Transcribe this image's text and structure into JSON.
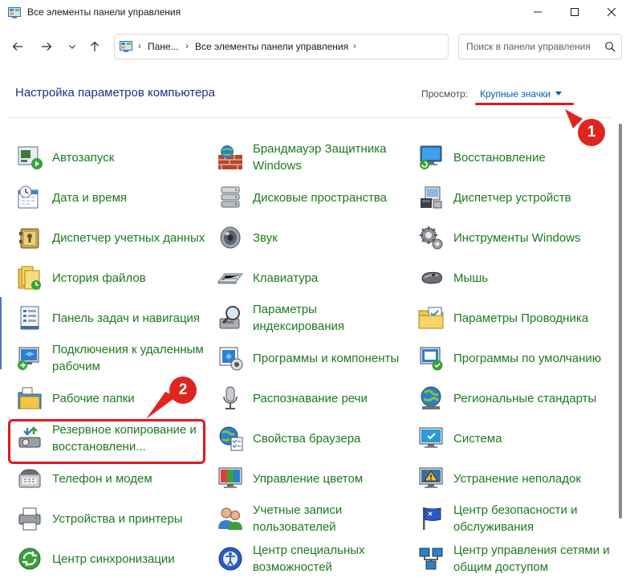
{
  "window": {
    "title": "Все элементы панели управления"
  },
  "address": {
    "crumbs": [
      "Пане...",
      "Все элементы панели управления"
    ]
  },
  "search": {
    "placeholder": "Поиск в панели управления"
  },
  "header": {
    "title": "Настройка параметров компьютера",
    "view_label": "Просмотр:",
    "view_value": "Крупные значки"
  },
  "callouts": {
    "one": "1",
    "two": "2"
  },
  "colors": {
    "link_green": "#1d7a1d",
    "heading_blue": "#1e3287",
    "callout_red": "#e0251f"
  },
  "items": [
    {
      "label": "Автозапуск",
      "icon": "autoplay-icon"
    },
    {
      "label": "Брандмауэр Защитника Windows",
      "icon": "firewall-icon"
    },
    {
      "label": "Восстановление",
      "icon": "recovery-icon"
    },
    {
      "label": "Дата и время",
      "icon": "date-time-icon"
    },
    {
      "label": "Дисковые пространства",
      "icon": "storage-spaces-icon"
    },
    {
      "label": "Диспетчер устройств",
      "icon": "device-manager-icon"
    },
    {
      "label": "Диспетчер учетных данных",
      "icon": "credential-manager-icon"
    },
    {
      "label": "Звук",
      "icon": "sound-icon"
    },
    {
      "label": "Инструменты Windows",
      "icon": "windows-tools-icon"
    },
    {
      "label": "История файлов",
      "icon": "file-history-icon"
    },
    {
      "label": "Клавиатура",
      "icon": "keyboard-icon"
    },
    {
      "label": "Мышь",
      "icon": "mouse-icon"
    },
    {
      "label": "Панель задач и навигация",
      "icon": "taskbar-icon"
    },
    {
      "label": "Параметры индексирования",
      "icon": "indexing-icon"
    },
    {
      "label": "Параметры Проводника",
      "icon": "explorer-options-icon"
    },
    {
      "label": "Подключения к удаленным рабочим",
      "icon": "remote-desktop-icon"
    },
    {
      "label": "Программы и компоненты",
      "icon": "programs-features-icon"
    },
    {
      "label": "Программы по умолчанию",
      "icon": "default-programs-icon"
    },
    {
      "label": "Рабочие папки",
      "icon": "work-folders-icon"
    },
    {
      "label": "Распознавание речи",
      "icon": "speech-recognition-icon"
    },
    {
      "label": "Региональные стандарты",
      "icon": "region-icon"
    },
    {
      "label": "Резервное копирование и восстановлени...",
      "icon": "backup-restore-icon"
    },
    {
      "label": "Свойства браузера",
      "icon": "internet-options-icon"
    },
    {
      "label": "Система",
      "icon": "system-icon"
    },
    {
      "label": "Телефон и модем",
      "icon": "phone-modem-icon"
    },
    {
      "label": "Управление цветом",
      "icon": "color-management-icon"
    },
    {
      "label": "Устранение неполадок",
      "icon": "troubleshooting-icon"
    },
    {
      "label": "Устройства и принтеры",
      "icon": "devices-printers-icon"
    },
    {
      "label": "Учетные записи пользователей",
      "icon": "user-accounts-icon"
    },
    {
      "label": "Центр безопасности и обслуживания",
      "icon": "security-maintenance-icon"
    },
    {
      "label": "Центр синхронизации",
      "icon": "sync-center-icon"
    },
    {
      "label": "Центр специальных возможностей",
      "icon": "ease-of-access-icon"
    },
    {
      "label": "Центр управления сетями и общим доступом",
      "icon": "network-sharing-icon"
    }
  ]
}
